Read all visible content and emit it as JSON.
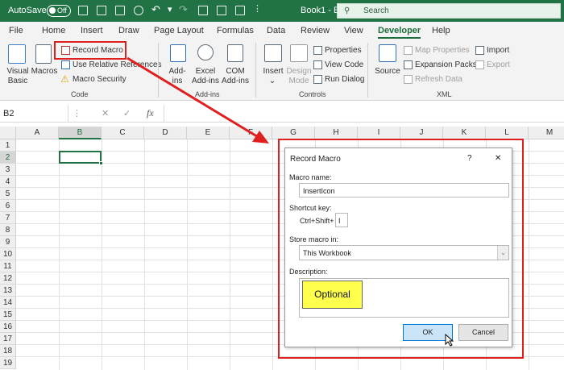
{
  "titlebar": {
    "autosave_label": "AutoSave",
    "autosave_state": "Off",
    "workbook": "Book1 - E...",
    "search_placeholder": "Search"
  },
  "tabs": [
    "File",
    "Home",
    "Insert",
    "Draw",
    "Page Layout",
    "Formulas",
    "Data",
    "Review",
    "View",
    "Developer",
    "Help"
  ],
  "ribbon": {
    "code": {
      "visual_basic": "Visual Basic",
      "macros": "Macros",
      "record_macro": "Record Macro",
      "relative_refs": "Use Relative References",
      "macro_security": "Macro Security",
      "group": "Code"
    },
    "addins": {
      "addins": "Add-ins",
      "excel_addins": "Excel Add-ins",
      "com_addins": "COM Add-ins",
      "group": "Add-ins"
    },
    "controls": {
      "insert": "Insert",
      "design_mode": "Design Mode",
      "properties": "Properties",
      "view_code": "View Code",
      "run_dialog": "Run Dialog",
      "group": "Controls"
    },
    "xml": {
      "source": "Source",
      "map_properties": "Map Properties",
      "expansion_packs": "Expansion Packs",
      "refresh_data": "Refresh Data",
      "import": "Import",
      "export": "Export",
      "group": "XML"
    }
  },
  "formula_bar": {
    "name_box": "B2",
    "cancel_glyph": "✕",
    "enter_glyph": "✓",
    "fx": "fx"
  },
  "columns": [
    "A",
    "B",
    "C",
    "D",
    "E",
    "F",
    "G",
    "H",
    "I",
    "J",
    "K",
    "L",
    "M"
  ],
  "rows": [
    "1",
    "2",
    "3",
    "4",
    "5",
    "6",
    "7",
    "8",
    "9",
    "10",
    "11",
    "12",
    "13",
    "14",
    "15",
    "16",
    "17",
    "18",
    "19"
  ],
  "dialog": {
    "title": "Record Macro",
    "help": "?",
    "close": "✕",
    "macro_name_label": "Macro name:",
    "macro_name_value": "InsertIcon",
    "shortcut_label": "Shortcut key:",
    "shortcut_prefix": "Ctrl+Shift+",
    "shortcut_value": "I",
    "store_label": "Store macro in:",
    "store_value": "This Workbook",
    "description_label": "Description:",
    "ok": "OK",
    "cancel": "Cancel"
  },
  "annotation": {
    "optional": "Optional"
  },
  "colors": {
    "excel_green": "#217346",
    "highlight_red": "#e02020",
    "callout_yellow": "#ffff4d"
  }
}
